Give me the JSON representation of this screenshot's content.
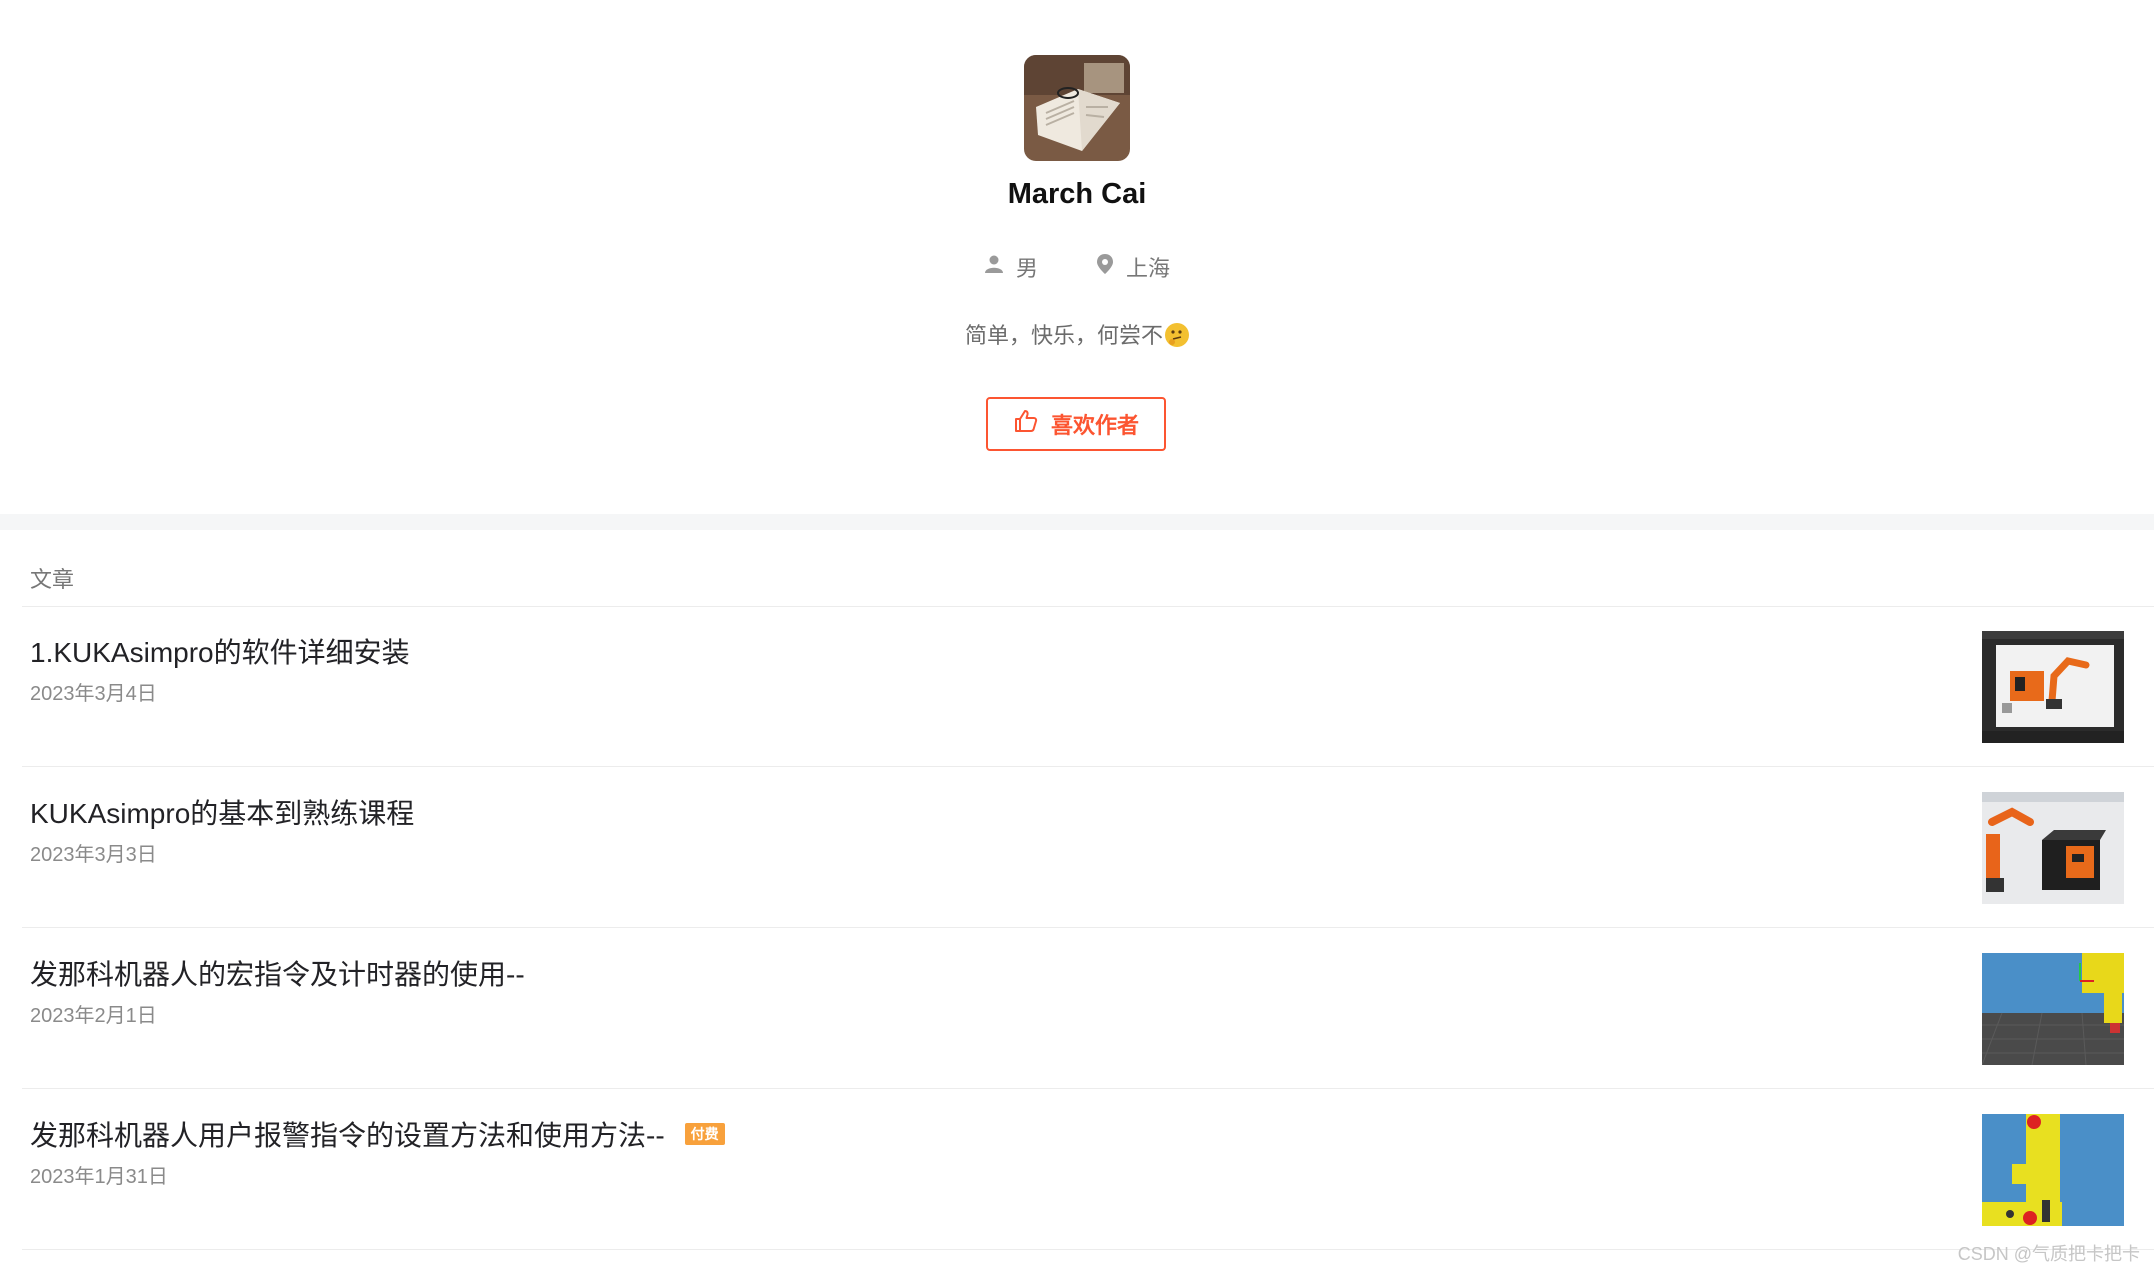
{
  "profile": {
    "name": "March Cai",
    "gender": "男",
    "location": "上海",
    "bio": "简单，快乐，何尝不",
    "like_button": "喜欢作者"
  },
  "section": {
    "label": "文章"
  },
  "articles": [
    {
      "title": "1.KUKAsimpro的软件详细安装",
      "date": "2023年3月4日",
      "badge": ""
    },
    {
      "title": "KUKAsimpro的基本到熟练课程",
      "date": "2023年3月3日",
      "badge": ""
    },
    {
      "title": "发那科机器人的宏指令及计时器的使用--",
      "date": "2023年2月1日",
      "badge": ""
    },
    {
      "title": "发那科机器人用户报警指令的设置方法和使用方法--",
      "date": "2023年1月31日",
      "badge": "付费"
    }
  ],
  "watermark": "CSDN @气质把卡把卡",
  "colors": {
    "accent": "#fc5531",
    "badge": "#f8a13c"
  }
}
